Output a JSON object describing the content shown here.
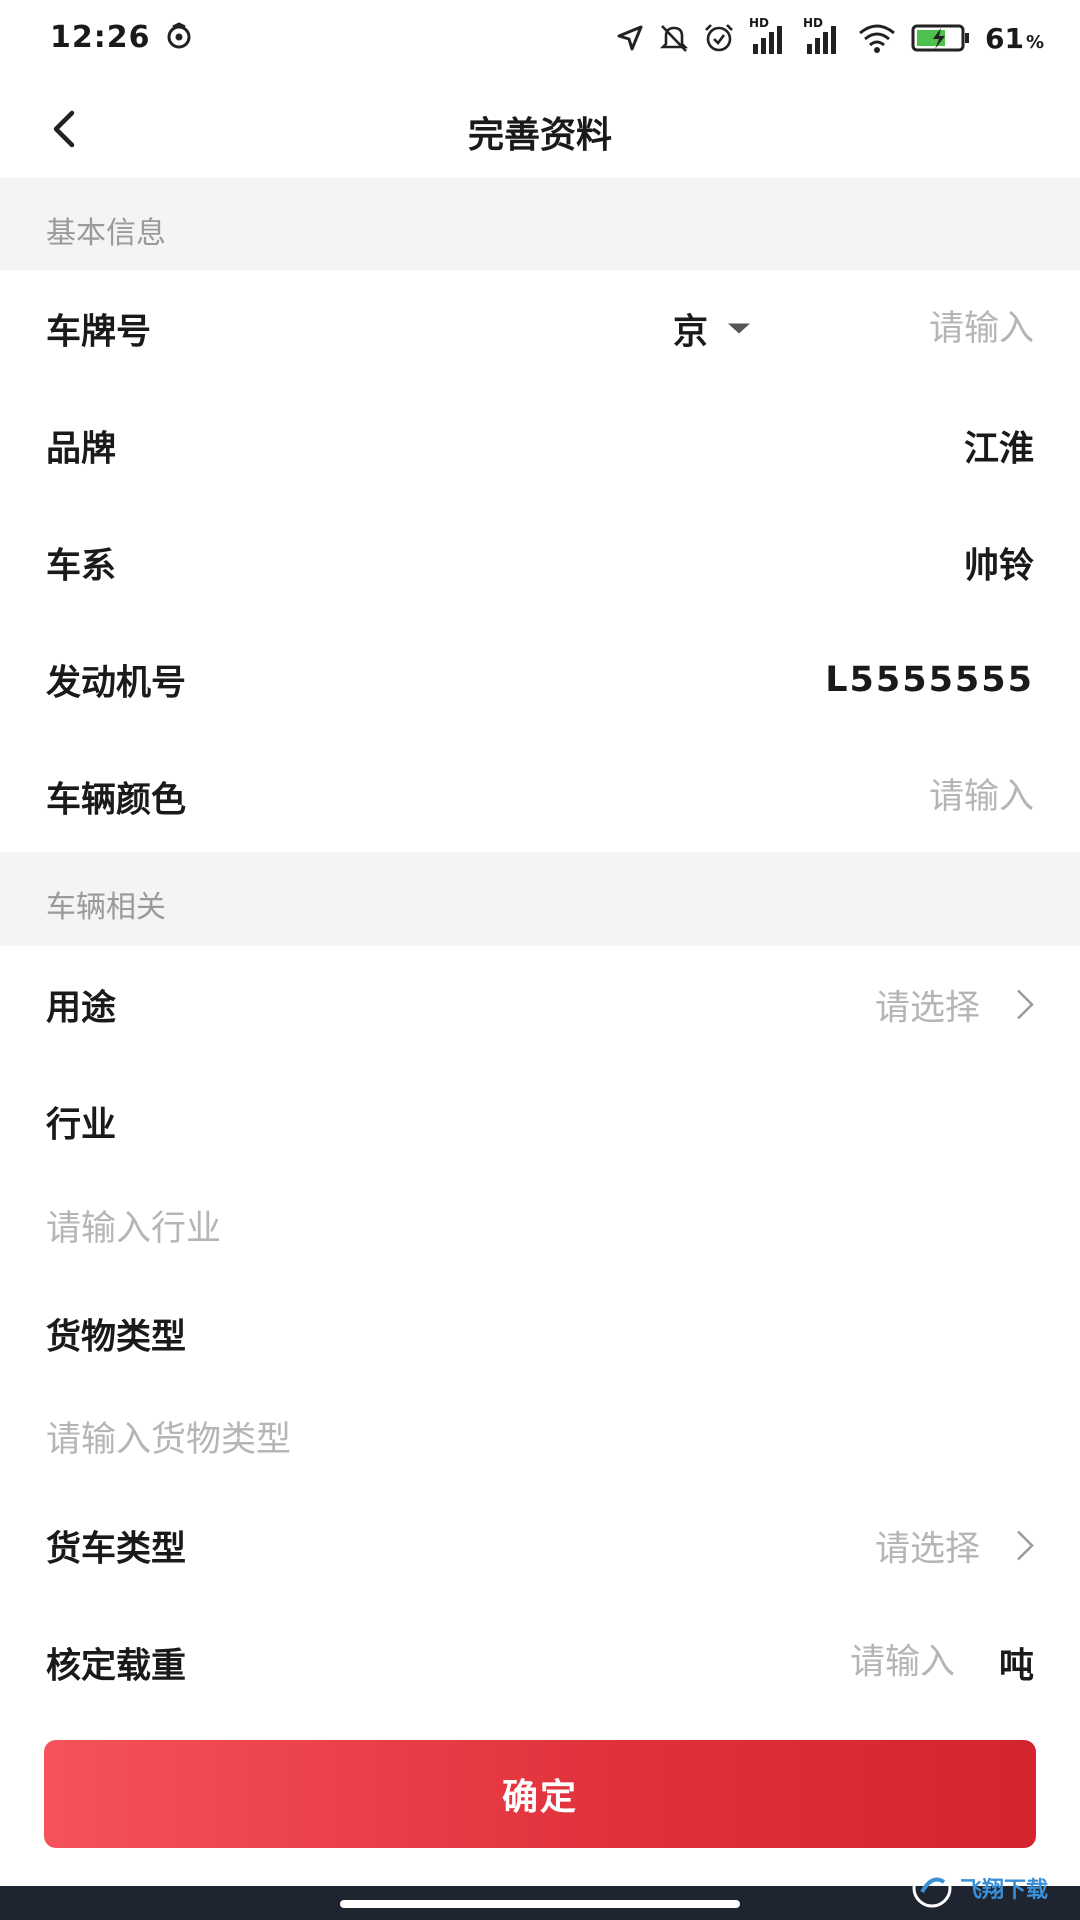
{
  "status_bar": {
    "time": "12:26",
    "battery_percent": "61",
    "battery_unit": "%",
    "hd_label_1": "HD",
    "hd_label_2": "HD"
  },
  "header": {
    "title": "完善资料"
  },
  "sections": {
    "basic": "基本信息",
    "vehicle": "车辆相关"
  },
  "basic_info": {
    "plate_label": "车牌号",
    "plate_prefix": "京",
    "plate_placeholder": "请输入",
    "brand_label": "品牌",
    "brand_value": "江淮",
    "series_label": "车系",
    "series_value": "帅铃",
    "engine_label": "发动机号",
    "engine_value": "L5555555",
    "color_label": "车辆颜色",
    "color_placeholder": "请输入"
  },
  "vehicle_info": {
    "usage_label": "用途",
    "usage_placeholder": "请选择",
    "industry_label": "行业",
    "industry_placeholder": "请输入行业",
    "cargo_label": "货物类型",
    "cargo_placeholder": "请输入货物类型",
    "truck_type_label": "货车类型",
    "truck_type_placeholder": "请选择",
    "load_label": "核定载重",
    "load_placeholder": "请输入",
    "load_unit": "吨"
  },
  "actions": {
    "confirm_label": "确定"
  },
  "watermark": {
    "text": "飞翔下载"
  },
  "colors": {
    "accent": "#e0303a",
    "placeholder": "#b5b5b5",
    "section_bg": "#f4f4f4"
  }
}
